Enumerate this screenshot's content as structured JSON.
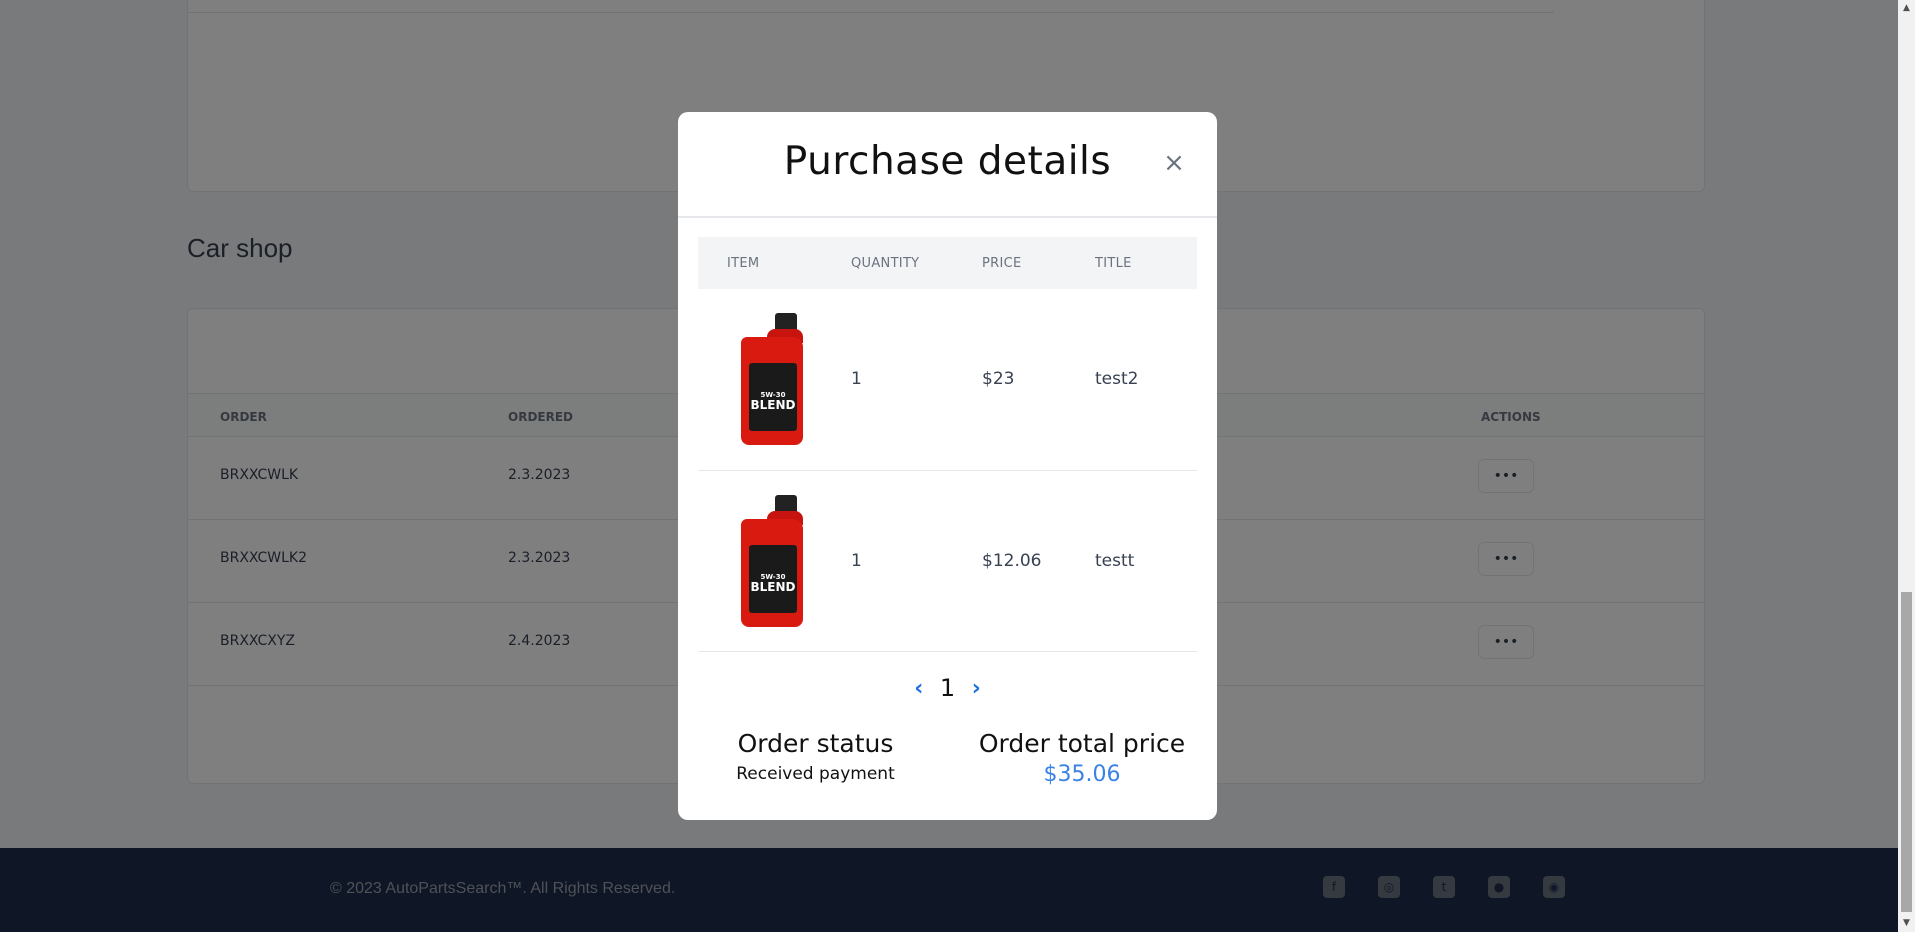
{
  "background": {
    "section_title": "Car shop",
    "orders_table": {
      "headers": [
        "ORDER",
        "ORDERED",
        "ACTIONS"
      ],
      "rows": [
        {
          "order": "BRXXCWLK",
          "date": "2.3.2023",
          "action": "•••"
        },
        {
          "order": "BRXXCWLK2",
          "date": "2.3.2023",
          "action": "•••"
        },
        {
          "order": "BRXXCXYZ",
          "date": "2.4.2023",
          "action": "•••"
        }
      ]
    },
    "footer": {
      "copyright": "© 2023 AutoPartsSearch™. All Rights Reserved.",
      "social_icons": [
        "facebook-icon",
        "instagram-icon",
        "twitter-icon",
        "github-icon",
        "dribbble-icon"
      ]
    }
  },
  "modal": {
    "title": "Purchase details",
    "close_label": "×",
    "table": {
      "headers": {
        "item": "ITEM",
        "quantity": "QUANTITY",
        "price": "PRICE",
        "title": "TITLE"
      },
      "rows": [
        {
          "quantity": "1",
          "price": "$23",
          "title": "test2",
          "image": "motor-oil-bottle"
        },
        {
          "quantity": "1",
          "price": "$12.06",
          "title": "testt",
          "image": "motor-oil-bottle"
        }
      ]
    },
    "pagination": {
      "prev": "‹",
      "page": "1",
      "next": "›"
    },
    "order_status": {
      "label": "Order status",
      "value": "Received payment"
    },
    "order_total": {
      "label": "Order total price",
      "value": "$35.06"
    },
    "colors": {
      "accent": "#3b82e6",
      "link": "#1d6fe0"
    }
  }
}
